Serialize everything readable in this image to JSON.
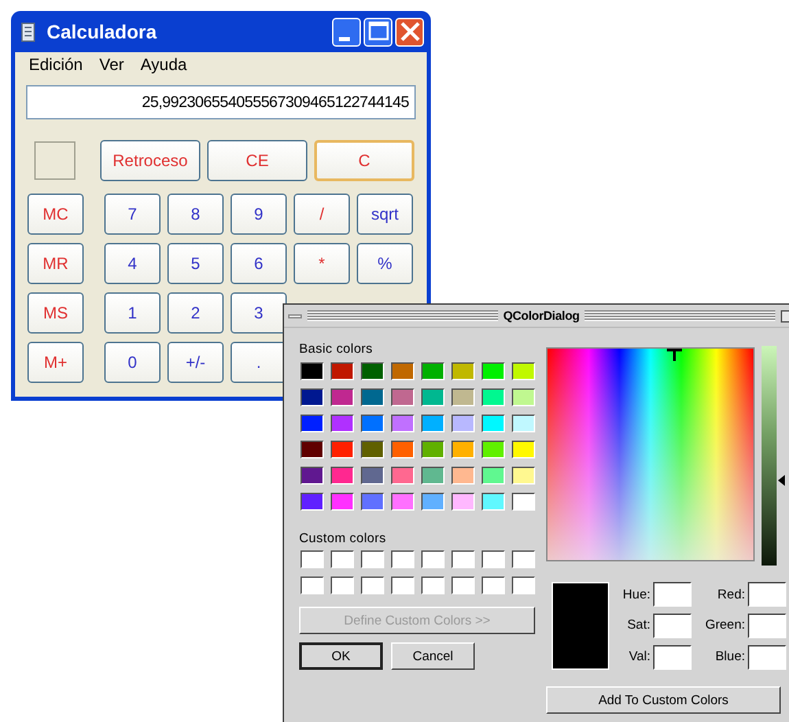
{
  "calculator": {
    "window": {
      "title": "Calculadora"
    },
    "menu": [
      "Edición",
      "Ver",
      "Ayuda"
    ],
    "display": {
      "value": "25,9923065540555673094651227441​45"
    },
    "top_keys": [
      {
        "label": "Retroceso",
        "kind": "wide",
        "default": false
      },
      {
        "label": "CE",
        "kind": "wide",
        "default": false
      },
      {
        "label": "C",
        "kind": "wide",
        "default": true
      }
    ],
    "memory_keys": [
      {
        "label": "MC"
      },
      {
        "label": "MR"
      },
      {
        "label": "MS"
      },
      {
        "label": "M+"
      }
    ],
    "key_rows": [
      [
        {
          "label": "7",
          "color": "#3232c8"
        },
        {
          "label": "8",
          "color": "#3232c8"
        },
        {
          "label": "9",
          "color": "#3232c8"
        },
        {
          "label": "/",
          "color": "#e03030"
        },
        {
          "label": "sqrt",
          "color": "#3232c8"
        }
      ],
      [
        {
          "label": "4",
          "color": "#3232c8"
        },
        {
          "label": "5",
          "color": "#3232c8"
        },
        {
          "label": "6",
          "color": "#3232c8"
        },
        {
          "label": "*",
          "color": "#e03030"
        },
        {
          "label": "%",
          "color": "#3232c8"
        }
      ],
      [
        {
          "label": "1",
          "color": "#3232c8"
        },
        {
          "label": "2",
          "color": "#3232c8"
        },
        {
          "label": "3",
          "color": "#3232c8"
        }
      ],
      [
        {
          "label": "0",
          "color": "#3232c8"
        },
        {
          "label": "+/-",
          "color": "#3232c8"
        },
        {
          "label": ".",
          "color": "#3232c8"
        }
      ]
    ]
  },
  "color_dialog": {
    "window": {
      "title": "QColorDialog"
    },
    "basic_colors_label": "Basic colors",
    "basic_colors": [
      {
        "color": "#000000"
      },
      {
        "color": "#c01800"
      },
      {
        "color": "#006000"
      },
      {
        "color": "#c06800"
      },
      {
        "color": "#00b000"
      },
      {
        "color": "#c0b800"
      },
      {
        "color": "#00f000"
      },
      {
        "color": "#c0f800"
      },
      {
        "color": "#001890"
      },
      {
        "color": "#c02890"
      },
      {
        "color": "#006890"
      },
      {
        "color": "#c06890"
      },
      {
        "color": "#00b890"
      },
      {
        "color": "#c0b890"
      },
      {
        "color": "#00f890"
      },
      {
        "color": "#c0f890"
      },
      {
        "color": "#0020ff"
      },
      {
        "color": "#b030ff"
      },
      {
        "color": "#0070ff"
      },
      {
        "color": "#c070ff"
      },
      {
        "color": "#00b0ff"
      },
      {
        "color": "#b8b8ff"
      },
      {
        "color": "#00f8ff"
      },
      {
        "color": "#c0f8ff"
      },
      {
        "color": "#600000"
      },
      {
        "color": "#ff2000"
      },
      {
        "color": "#606000"
      },
      {
        "color": "#ff6000"
      },
      {
        "color": "#60b000"
      },
      {
        "color": "#ffb000"
      },
      {
        "color": "#60f000"
      },
      {
        "color": "#fff800"
      },
      {
        "color": "#601890"
      },
      {
        "color": "#ff2890"
      },
      {
        "color": "#606890"
      },
      {
        "color": "#ff6890"
      },
      {
        "color": "#60b890"
      },
      {
        "color": "#ffb890"
      },
      {
        "color": "#60f890"
      },
      {
        "color": "#fff890"
      },
      {
        "color": "#6020ff"
      },
      {
        "color": "#ff30ff"
      },
      {
        "color": "#6070ff"
      },
      {
        "color": "#ff70ff"
      },
      {
        "color": "#60b0ff"
      },
      {
        "color": "#ffb8ff"
      },
      {
        "color": "#60f8ff"
      },
      {
        "color": "#ffffff"
      }
    ],
    "custom_colors_label": "Custom colors",
    "custom_colors": [
      {
        "color": "#ffffff"
      },
      {
        "color": "#ffffff"
      },
      {
        "color": "#ffffff"
      },
      {
        "color": "#ffffff"
      },
      {
        "color": "#ffffff"
      },
      {
        "color": "#ffffff"
      },
      {
        "color": "#ffffff"
      },
      {
        "color": "#ffffff"
      },
      {
        "color": "#ffffff"
      },
      {
        "color": "#ffffff"
      },
      {
        "color": "#ffffff"
      },
      {
        "color": "#ffffff"
      },
      {
        "color": "#ffffff"
      },
      {
        "color": "#ffffff"
      },
      {
        "color": "#ffffff"
      },
      {
        "color": "#ffffff"
      }
    ],
    "define_button": {
      "label": "Define Custom Colors >>",
      "disabled": true
    },
    "value_slider": {
      "level": 0.39
    },
    "preview": {
      "color": "#000000"
    },
    "fields": [
      {
        "label": "Hue:"
      },
      {
        "label": "Red:"
      },
      {
        "label": "Sat:"
      },
      {
        "label": "Green:"
      },
      {
        "label": "Val:"
      },
      {
        "label": "Blue:"
      }
    ],
    "buttons": [
      {
        "label": "OK",
        "default": true
      },
      {
        "label": "Cancel",
        "default": false
      }
    ],
    "add_button": {
      "label": "Add To Custom Colors"
    }
  }
}
